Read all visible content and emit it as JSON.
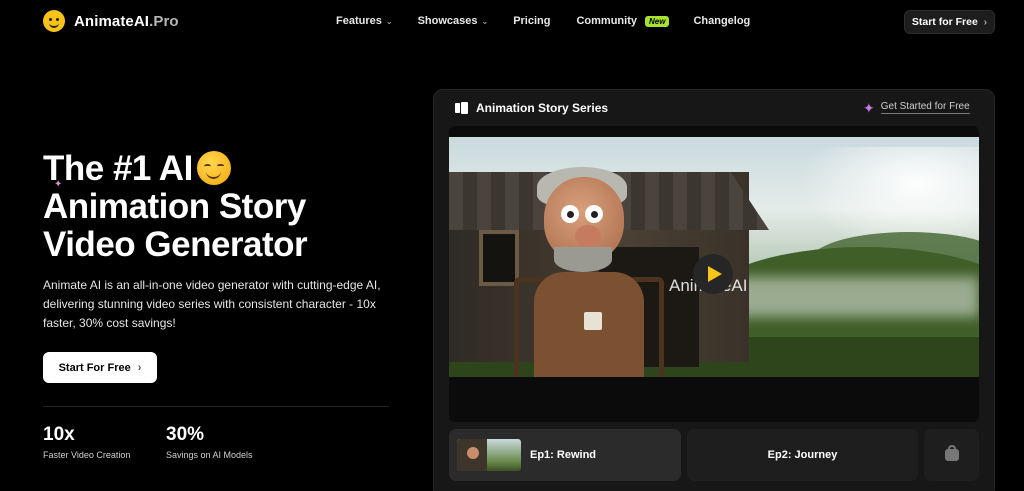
{
  "brand": {
    "name_main": "AnimateAI",
    "name_suffix": ".Pro"
  },
  "nav": {
    "items": [
      {
        "label": "Features",
        "has_dropdown": true
      },
      {
        "label": "Showcases",
        "has_dropdown": true
      },
      {
        "label": "Pricing",
        "has_dropdown": false
      },
      {
        "label": "Community",
        "has_dropdown": false,
        "badge": "New"
      },
      {
        "label": "Changelog",
        "has_dropdown": false
      }
    ],
    "cta_label": "Start for Free"
  },
  "hero": {
    "title_line1": "The #1 AI",
    "title_line2": "Animation Story",
    "title_line3": "Video Generator",
    "description": "Animate AI is an all-in-one video generator with cutting-edge AI, delivering stunning video series with consistent character - 10x faster, 30% cost savings!",
    "cta_label": "Start For Free",
    "stats": [
      {
        "value": "10x",
        "label": "Faster Video Creation"
      },
      {
        "value": "30%",
        "label": "Savings on AI Models"
      }
    ]
  },
  "panel": {
    "title": "Animation Story Series",
    "link_label": "Get Started for Free",
    "video_watermark": "AnimateAI",
    "episodes": [
      {
        "label": "Ep1: Rewind",
        "active": true
      },
      {
        "label": "Ep2: Journey",
        "active": false
      }
    ]
  },
  "colors": {
    "accent_yellow": "#f5c518",
    "new_badge": "#a6e22e",
    "sparkle": "#c27be0"
  }
}
